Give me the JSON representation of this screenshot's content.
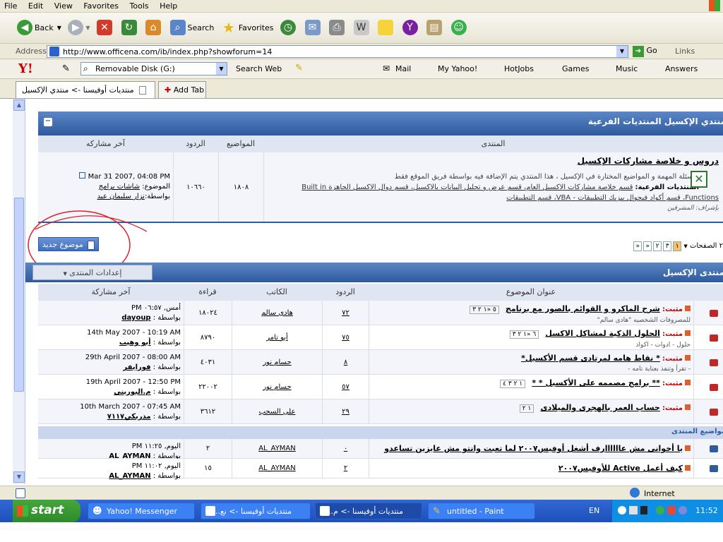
{
  "menu": [
    "File",
    "Edit",
    "View",
    "Favorites",
    "Tools",
    "Help"
  ],
  "toolbar": {
    "back": "Back",
    "search": "Search",
    "favorites": "Favorites"
  },
  "address": {
    "label": "Address",
    "url": "http://www.officena.com/ib/index.php?showforum=14",
    "go": "Go",
    "links": "Links"
  },
  "yahoo": {
    "logo": "Y!",
    "removable": "Removable Disk (G:)",
    "search_web": "Search Web",
    "mail": "Mail",
    "my_yahoo": "My Yahoo!",
    "hotjobs": "HotJobs",
    "games": "Games",
    "music": "Music",
    "answers": "Answers"
  },
  "tabs": {
    "current": "منتديات أوفيسنا -> منتدي الإكسيل",
    "add": "Add Tab"
  },
  "subforums": {
    "title": "منتدي الإكسيل المنتديات الفرعية",
    "headers": {
      "forum": "المنتدى",
      "topics": "المواضيع",
      "replies": "الردود",
      "last": "آخر مشاركه"
    },
    "row": {
      "name": "دروس و خلاصة مشاركات الإكسيل",
      "desc": "الأسئلة المهمة و المواضيع المختارة في الإكسيل ، هذا المنتدي يتم الإضافة فيه بواسطة فريق الموقع فقط",
      "sub_label": "المنتديات الفرعية:",
      "sub_links_1": "قسم خلاصة مشاركات الاكسيل العام، قسم عرض و تحليل البيانات بالاكسيل، قسم دوال الاكسيل الجاهزة Built in",
      "sub_links_2": "Functions، قسم أكواد فيجوال بيزيك التطبيقات - VBA، قسم التطبيقات",
      "mods": "بإشراف: المشرفين",
      "topics": "١٨٠٨",
      "replies": "١٠٦٦٠",
      "last_date": "Mar 31 2007, 04:08 PM",
      "last_topic_label": "الموضوع:",
      "last_topic": "شاشات برامج",
      "last_by_label": "بواسطة:",
      "last_by": "نزار سليمان عيد"
    }
  },
  "actions": {
    "new_topic": "موضوع جديد",
    "pages_label": "٢ الصفحات",
    "pages": [
      "«",
      "«",
      "٢",
      "٣",
      "١"
    ],
    "forum_options": "إعدادات المنتدى",
    "forum_title": "منتدى الإكسيل"
  },
  "topics_header": {
    "title": "عنوان الموضوع",
    "replies": "الردود",
    "author": "الكاتب",
    "views": "قراءة",
    "last": "آخر مشاركة"
  },
  "pinned": [
    {
      "prefix": "مثبت:",
      "title": "شرح الماكرو و القوائم بالصور مع برنامج",
      "sub": "للمصروفات الشخصيه \"هادى سالم\"",
      "pages": "٥ «١ ٢ ٣",
      "replies": "٧٢",
      "author": "هادى سالم",
      "views": "١٨٠٢٤",
      "last_date": "أمس, ٠٦:٥٧ PM",
      "last_by_label": "بواسطة :",
      "last_by": "dayoup"
    },
    {
      "prefix": "مثبت:",
      "title": "الحلول الذكية لمشاكل الاكسل",
      "sub": "حلول - ادوات - اكواد",
      "pages": "٦ «١ ٢ ٣",
      "replies": "٧٥",
      "author": "أبو تامر",
      "views": "٨٧٩٠",
      "last_date": "14th May 2007 - 10:19 AM",
      "last_by_label": "بواسطة :",
      "last_by": "أبو وهيب"
    },
    {
      "prefix": "مثبت:",
      "title": "* نقاط هامه لمرتادى قسم الأكسيل*",
      "sub": "- تقرأ وتنفذ بعناية تامه -",
      "pages": "",
      "replies": "٨",
      "author": "حسام نور",
      "views": "٤٠٣١",
      "last_date": "29th April 2007 - 08:00 AM",
      "last_by_label": "بواسطة :",
      "last_by": "فورايفر"
    },
    {
      "prefix": "مثبت:",
      "title": "** برامج مصممه على الأكسيل * *",
      "sub": "",
      "pages": "١ ٢ ٣ ٤",
      "replies": "٥٧",
      "author": "حسام نور",
      "views": "٢٢٠٠٢",
      "last_date": "19th April 2007 - 12:50 PM",
      "last_by_label": "بواسطة :",
      "last_by": "م.البورينى"
    },
    {
      "prefix": "مثبت:",
      "title": "حساب العمر بالهجرى والميلادى",
      "sub": "",
      "pages": "١ ٢",
      "replies": "٢٩",
      "author": "على السحب",
      "views": "٣٦١٢",
      "last_date": "10th March 2007 - 07:45 AM",
      "last_by_label": "بواسطة :",
      "last_by": "مدربكي٧١١٧"
    }
  ],
  "section_label": "مواضيع المنتدى",
  "topics": [
    {
      "title": "يا أخوانى مش عاااااارف أشغل أوفيس٢٠٠٧ لما تعبت وانتو مش عايزين تساعدو",
      "replies": "٠",
      "author": "AL_AYMAN",
      "views": "٢",
      "last_date": "اليوم, ١١:٢٥ PM",
      "last_by_label": "بواسطة :",
      "last_by": "AL_AYMAN"
    },
    {
      "title": "كيف أعمل Active للأوفيس٢٠٠٧",
      "replies": "٢",
      "author": "AL_AYMAN",
      "views": "١٥",
      "last_date": "اليوم, ١١:٠٢ PM",
      "last_by_label": "بواسطة :",
      "last_by": "AL_AYMAN"
    }
  ],
  "status": {
    "zone": "Internet"
  },
  "taskbar": {
    "start": "start",
    "items": [
      "Yahoo! Messenger",
      "منتديات أوفيسنا -> نع...",
      "منتديات أوفيسنا -> م...",
      "untitled - Paint"
    ],
    "lang": "EN",
    "clock": "11:52"
  },
  "colors": {
    "accent": "#2e5a9e",
    "header": "#dfe6f1",
    "annotation": "#e0202a"
  }
}
